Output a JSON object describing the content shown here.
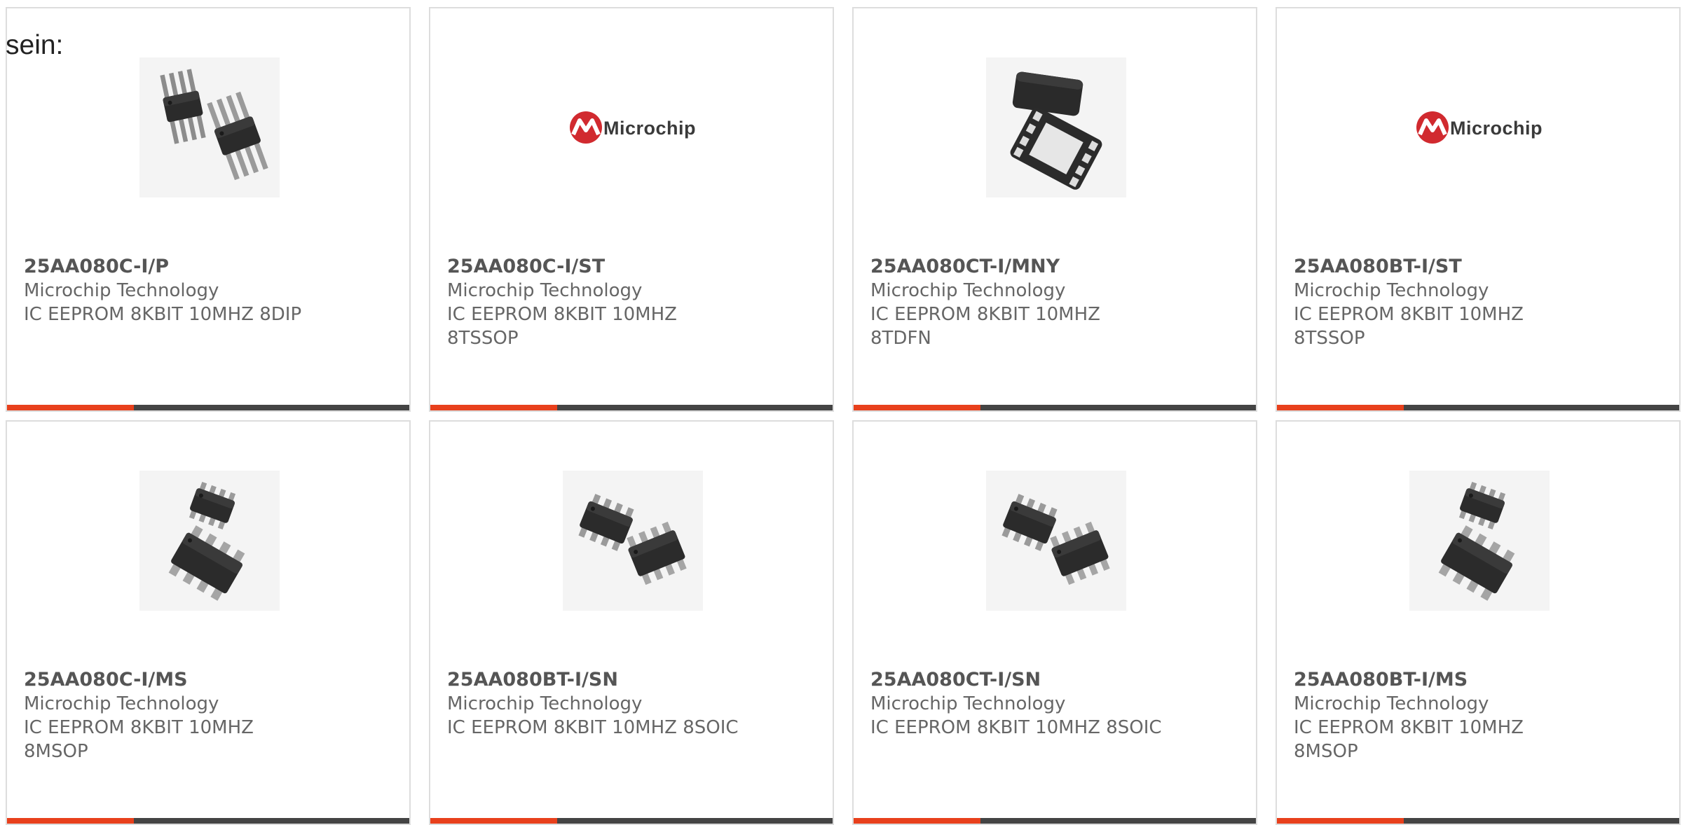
{
  "intro": "sein:",
  "colors": {
    "accent": "#e8401c",
    "bar": "#444444",
    "border": "#dddddd",
    "logo_red": "#d12a2f"
  },
  "accent_fraction": 0.315,
  "products": [
    {
      "part_number": "25AA080C-I/P",
      "manufacturer": "Microchip Technology",
      "description": "IC EEPROM 8KBIT 10MHZ 8DIP",
      "image": "dip-8-package-icon"
    },
    {
      "part_number": "25AA080C-I/ST",
      "manufacturer": "Microchip Technology",
      "description": "IC EEPROM 8KBIT 10MHZ 8TSSOP",
      "image": "microchip-logo",
      "logo_text": "Microchip"
    },
    {
      "part_number": "25AA080CT-I/MNY",
      "manufacturer": "Microchip Technology",
      "description": "IC EEPROM 8KBIT 10MHZ 8TDFN",
      "image": "tdfn-package-icon"
    },
    {
      "part_number": "25AA080BT-I/ST",
      "manufacturer": "Microchip Technology",
      "description": "IC EEPROM 8KBIT 10MHZ 8TSSOP",
      "image": "microchip-logo",
      "logo_text": "Microchip"
    },
    {
      "part_number": "25AA080C-I/MS",
      "manufacturer": "Microchip Technology",
      "description": "IC EEPROM 8KBIT 10MHZ 8MSOP",
      "image": "msop-package-icon"
    },
    {
      "part_number": "25AA080BT-I/SN",
      "manufacturer": "Microchip Technology",
      "description": "IC EEPROM 8KBIT 10MHZ 8SOIC",
      "image": "soic-package-icon"
    },
    {
      "part_number": "25AA080CT-I/SN",
      "manufacturer": "Microchip Technology",
      "description": "IC EEPROM 8KBIT 10MHZ 8SOIC",
      "image": "soic-package-icon"
    },
    {
      "part_number": "25AA080BT-I/MS",
      "manufacturer": "Microchip Technology",
      "description": "IC EEPROM 8KBIT 10MHZ 8MSOP",
      "image": "msop-package-icon"
    }
  ]
}
